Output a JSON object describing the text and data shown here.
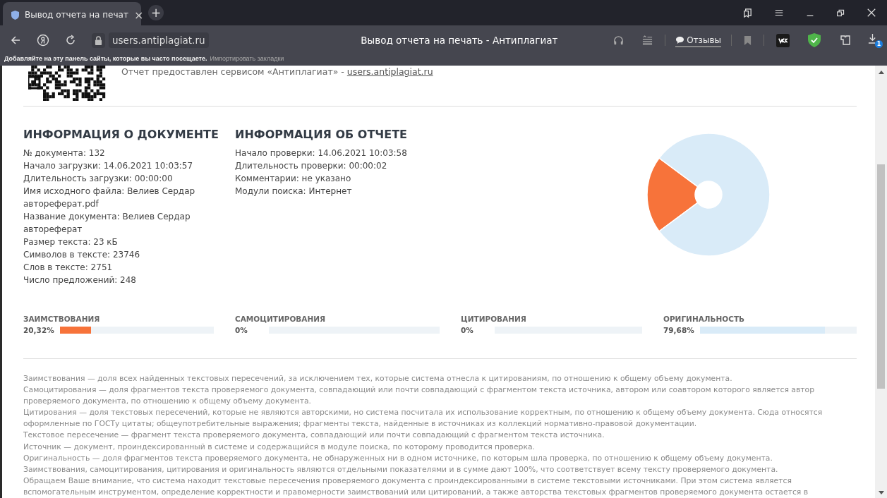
{
  "browser": {
    "tab": {
      "title": "Вывод отчета на печат",
      "close": "×"
    },
    "new_tab": "+",
    "address": "users.antiplagiat.ru",
    "page_title": "Вывод отчета на печать - Антиплагиат",
    "feedback": "Отзывы",
    "download_badge": "1",
    "bookmarks_hint": "Добавляйте на эту панель сайты, которые вы часто посещаете.",
    "import_link": "Импортировать закладки"
  },
  "report": {
    "provided_by": "Отчет предоставлен сервисом «Антиплагиат» - ",
    "provided_link": "users.antiplagiat.ru",
    "sections": [
      {
        "title": "ИНФОРМАЦИЯ О ДОКУМЕНТЕ",
        "lines": [
          "№ документа: 132",
          "Начало загрузки: 14.06.2021 10:03:57",
          "Длительность загрузки: 00:00:00",
          "Имя исходного файла: Велиев Сердар автореферат.pdf",
          "Название документа: Велиев Сердар автореферат",
          "Размер текста: 23 кБ",
          "Символов в тексте: 23746",
          "Слов в тексте: 2751",
          "Число предложений: 248"
        ]
      },
      {
        "title": "ИНФОРМАЦИЯ ОБ ОТЧЕТЕ",
        "lines": [
          "Начало проверки: 14.06.2021 10:03:58",
          "Длительность проверки: 00:00:02",
          "Комментарии: не указано",
          "Модули поиска: Интернет"
        ]
      }
    ],
    "metrics": [
      {
        "label": "ЗАИМСТВОВАНИЯ",
        "value": "20,32%",
        "level": 0.2032,
        "color": "#f7733a"
      },
      {
        "label": "САМОЦИТИРОВАНИЯ",
        "value": "0%",
        "level": 0
      },
      {
        "label": "ЦИТИРОВАНИЯ",
        "value": "0%",
        "level": 0
      },
      {
        "label": "ОРИГИНАЛЬНОСТЬ",
        "value": "79,68%",
        "level": 0.7968,
        "color": "#d9ebf8"
      }
    ],
    "notes": [
      "Заимствования — доля всех найденных текстовых пересечений, за исключением тех, которые система отнесла к цитированиям, по отношению к общему объему документа.",
      "Самоцитирования — доля фрагментов текста проверяемого документа, совпадающий или почти совпадающий с фрагментом текста источника, автором или соавтором которого является автор проверяемого документа, по отношению к общему объему документа.",
      "Цитирования — доля текстовых пересечений, которые не являются авторскими, но система посчитала их использование корректным, по отношению к общему объему документа. Сюда относятся оформленные по ГОСТу цитаты; общеупотребительные выражения; фрагменты текста, найденные в источниках из коллекций нормативно-правовой документации.",
      "Текстовое пересечение — фрагмент текста проверяемого документа, совпадающий или почти совпадающий с фрагментом текста источника.",
      "Источник — документ, проиндексированный в системе и содержащийся в модуле поиска, по которому проводится проверка.",
      "Оригинальность — доля фрагментов текста проверяемого документа, не обнаруженных ни в одном источнике, по которым шла проверка, по отношению к общему объему документа.",
      "Заимствования, самоцитирования, цитирования и оригинальность являются отдельными показателями и в сумме дают 100%, что соответствует всему тексту проверяемого документа.",
      "Обращаем Ваше внимание, что система находит текстовые пересечения проверяемого документа с проиндексированными в системе текстовыми источниками. При этом система является вспомогательным инструментом, определение корректности и правомерности заимствований или цитирований, а также авторства текстовых фрагментов проверяемого документа остается в"
    ]
  }
}
